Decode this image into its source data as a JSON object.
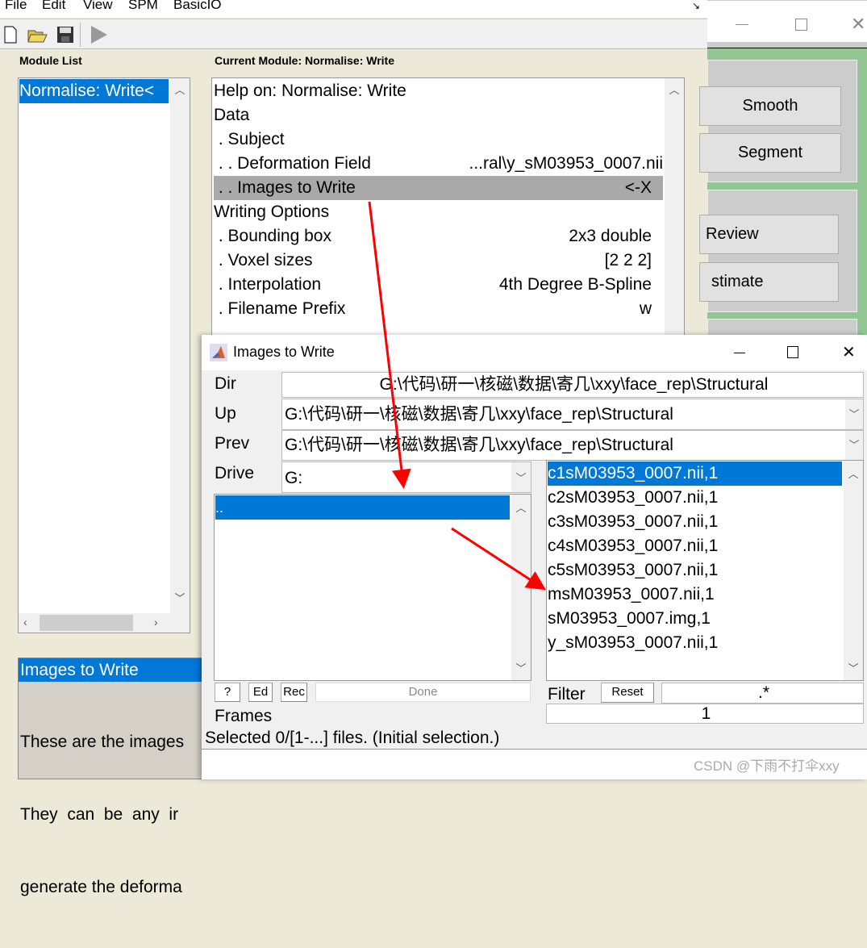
{
  "menu": [
    "File",
    "Edit",
    "View",
    "SPM",
    "BasicIO"
  ],
  "toolbar": {
    "icons": [
      "new-file-icon",
      "open-folder-icon",
      "save-icon",
      "run-icon"
    ]
  },
  "module_list": {
    "label": "Module List",
    "items": [
      "Normalise: Write<"
    ]
  },
  "current_module": {
    "label": "Current Module: Normalise: Write",
    "rows": [
      {
        "name": "Help on: Normalise: Write",
        "value": ""
      },
      {
        "name": "Data",
        "value": ""
      },
      {
        "name": " . Subject",
        "value": ""
      },
      {
        "name": " . . Deformation Field",
        "value": "...ral\\y_sM03953_0007.nii"
      },
      {
        "name": " . . Images to Write",
        "value": "<-X"
      },
      {
        "name": "Writing Options",
        "value": ""
      },
      {
        "name": " . Bounding box",
        "value": "2x3 double"
      },
      {
        "name": " . Voxel sizes",
        "value": "[2 2 2]"
      },
      {
        "name": " . Interpolation",
        "value": "4th Degree B-Spline"
      },
      {
        "name": " . Filename Prefix",
        "value": "w"
      }
    ],
    "selected_index": 4
  },
  "help": {
    "title": "Images to Write",
    "lines": [
      "These are the images",
      "They  can  be  any  ir",
      "generate the deforma"
    ]
  },
  "bg_window": {
    "buttons": [
      "Smooth",
      "Segment",
      "Review",
      "stimate"
    ]
  },
  "dialog": {
    "title": "Images to Write",
    "dir_label": "Dir",
    "dir": "G:\\代码\\研一\\核磁\\数据\\寄几\\xxy\\face_rep\\Structural",
    "up_label": "Up",
    "up": "G:\\代码\\研一\\核磁\\数据\\寄几\\xxy\\face_rep\\Structural",
    "prev_label": "Prev",
    "prev": "G:\\代码\\研一\\核磁\\数据\\寄几\\xxy\\face_rep\\Structural",
    "drive_label": "Drive",
    "drive": "G:",
    "dirs": [
      ".."
    ],
    "files": [
      "c1sM03953_0007.nii,1",
      "c2sM03953_0007.nii,1",
      "c3sM03953_0007.nii,1",
      "c4sM03953_0007.nii,1",
      "c5sM03953_0007.nii,1",
      "msM03953_0007.nii,1",
      "sM03953_0007.img,1",
      "y_sM03953_0007.nii,1"
    ],
    "selected_file": 0,
    "buttons": {
      "help": "?",
      "ed": "Ed",
      "rec": "Rec",
      "done": "Done",
      "reset": "Reset"
    },
    "filter_label": "Filter",
    "filter": ".*",
    "frames_label": "Frames",
    "frames": "1",
    "status": "Selected 0/[1-...] files. (Initial selection.)"
  },
  "watermark": "CSDN @下雨不打伞xxy",
  "colors": {
    "selection": "#0078d7",
    "annotation_arrow": "#ff0000",
    "bg_window": "#93c593"
  }
}
